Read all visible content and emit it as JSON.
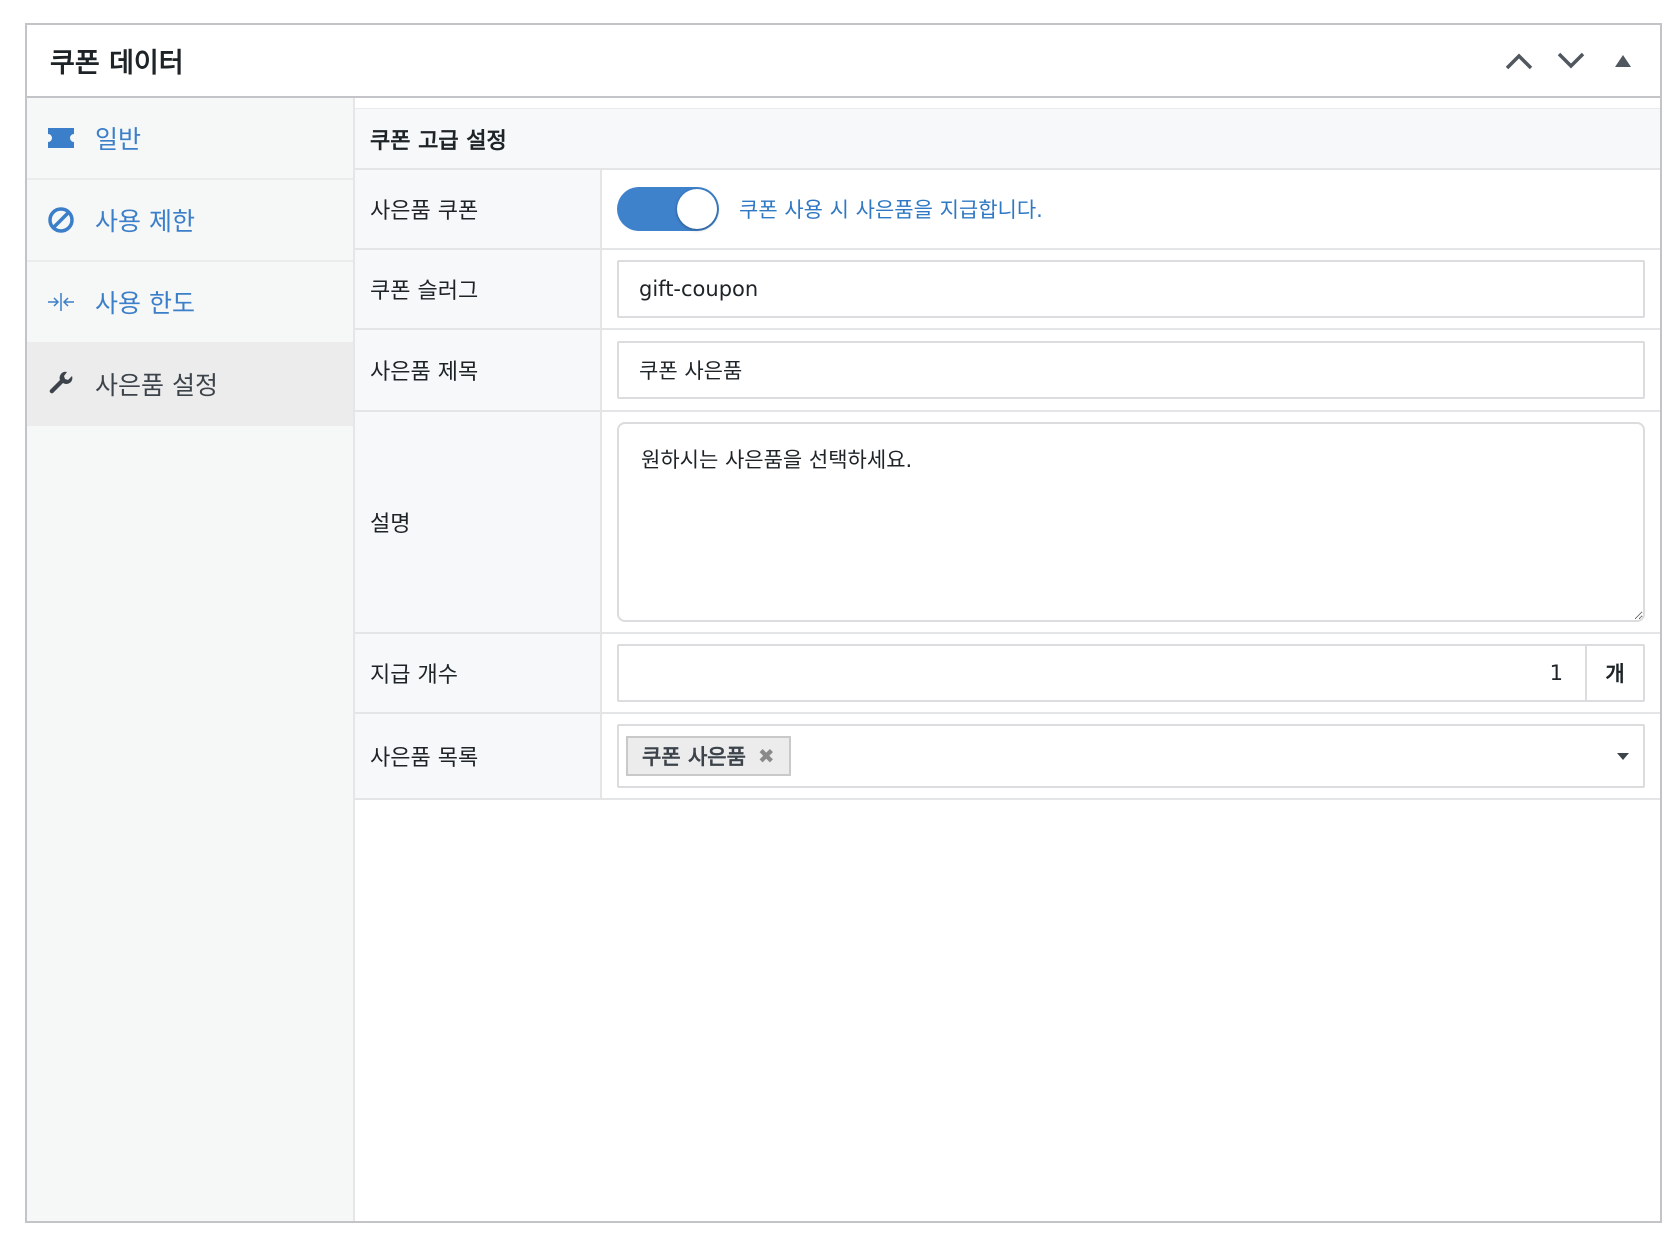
{
  "panel": {
    "title": "쿠폰 데이터",
    "controls": [
      {
        "icon": "chevron-up-icon"
      },
      {
        "icon": "chevron-down-icon"
      },
      {
        "icon": "caret-up-icon"
      }
    ]
  },
  "sidebar": {
    "tabs": [
      {
        "label": "일반",
        "icon": "ticket-icon"
      },
      {
        "label": "사용 제한",
        "icon": "prohibit-icon"
      },
      {
        "label": "사용 한도",
        "icon": "arrows-in-icon"
      },
      {
        "label": "사은품 설정",
        "icon": "wrench-icon",
        "active": true
      }
    ]
  },
  "section": {
    "title": "쿠폰 고급 설정"
  },
  "fields": {
    "gift_coupon": {
      "label": "사은품 쿠폰",
      "enabled": true,
      "description": "쿠폰 사용 시 사은품을 지급합니다."
    },
    "slug": {
      "label": "쿠폰 슬러그",
      "value": "gift-coupon"
    },
    "gift_title": {
      "label": "사은품 제목",
      "value": "쿠폰 사은품"
    },
    "description": {
      "label": "설명",
      "value": "원하시는 사은품을 선택하세요."
    },
    "quantity": {
      "label": "지급 개수",
      "value": "1",
      "unit": "개"
    },
    "gift_list": {
      "label": "사은품 목록",
      "selected": [
        "쿠폰 사은품"
      ],
      "remove_glyph": "✖"
    }
  },
  "colors": {
    "accent": "#3f82cc",
    "link": "#2f78c4"
  }
}
